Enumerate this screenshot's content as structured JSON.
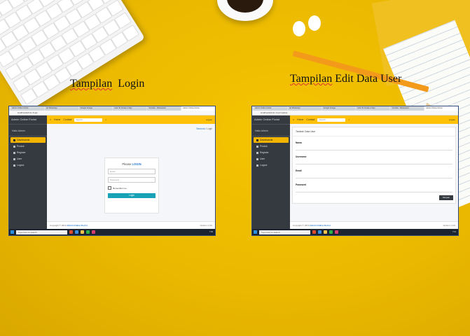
{
  "captions": {
    "login_left": "Tampilan",
    "login_right": "Login",
    "edit_first": "Tampilan",
    "edit_rest": " Edit Data User"
  },
  "login_screen": {
    "tabs": [
      "Admin Online Florist",
      "(2) WhatsApp",
      "Google Fotoga",
      "How To Create a Sign",
      "Youtube - Restaurant",
      "Admin Online Florist"
    ],
    "address": "localhost/admin  /login",
    "brand": "Admin Online Florist",
    "user": "Hallo Admin",
    "menu": [
      "Dashboards",
      "Produk",
      "Register",
      "User",
      "Logout"
    ],
    "topbar": {
      "home": "Home",
      "contact": "Contact",
      "search_placeholder": "Search",
      "logout": "Logout"
    },
    "breadcrumb": {
      "home": "Beranda",
      "sep": " / ",
      "current": "Login"
    },
    "login": {
      "title_prefix": "Please ",
      "title_emph": "LOGIN",
      "email_placeholder": "Email",
      "password_placeholder": "Password",
      "remember": "Remember me",
      "button": "Login"
    },
    "footer": {
      "copy": "Copyright © 2019 ",
      "brand": "Admin Online Florist",
      "version": "Version 1.0.0"
    },
    "taskbar": {
      "search": "Type here to search",
      "clock": "7:30"
    }
  },
  "edit_screen": {
    "tabs": [
      "Admin Online Florist",
      "(2) WhatsApp",
      "Google Fotoga",
      "How To Create a Sign",
      "Youtube - Restaurant",
      "Admin Online Florist"
    ],
    "address": "localhost/admin  /user/update",
    "brand": "Admin Online Florist",
    "user": "Hallo Admin",
    "menu": [
      "Dashboards",
      "Produk",
      "Register",
      "User",
      "Logout"
    ],
    "topbar": {
      "home": "Home",
      "contact": "Contact",
      "search_placeholder": "Search",
      "logout": "Logout"
    },
    "form": {
      "heading": "Tambah Data User",
      "labels": [
        "Nama",
        "Username",
        "Email",
        "Password"
      ],
      "button": "Simpan"
    },
    "footer": {
      "copy": "Copyright © 2019 ",
      "brand": "Admin Online Florist",
      "version": "Version 1.0.0"
    },
    "taskbar": {
      "search": "Type here to search",
      "clock": "7:31"
    }
  },
  "colors": {
    "background": "#f0bd00",
    "sidebar": "#343a40",
    "topbar": "#ffc107",
    "accent": "#2a7bd0",
    "login_button": "#17a2b8"
  }
}
